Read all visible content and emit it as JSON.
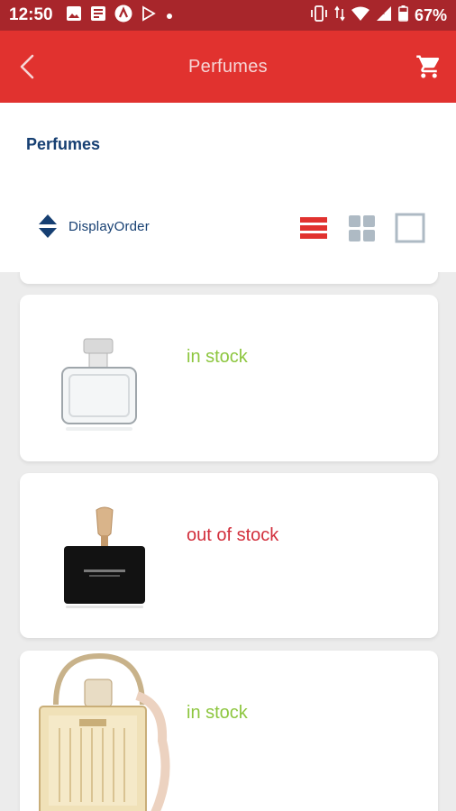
{
  "status_bar": {
    "time": "12:50",
    "battery": "67%",
    "icons": [
      "image-icon",
      "news-icon",
      "app-icon",
      "play-store-icon",
      "dot-icon",
      "vibrate-icon",
      "data-icon",
      "wifi-icon",
      "signal-icon",
      "battery-icon"
    ]
  },
  "app_bar": {
    "title": "Perfumes",
    "back_icon": "back-arrow-icon",
    "cart_icon": "cart-icon"
  },
  "category": {
    "title": "Perfumes"
  },
  "sort": {
    "label": "DisplayOrder",
    "icon": "sort-icon"
  },
  "view_modes": [
    {
      "name": "list-view",
      "active": true
    },
    {
      "name": "grid-view",
      "active": false
    },
    {
      "name": "single-view",
      "active": false
    }
  ],
  "products": [
    {
      "stock": "in stock",
      "in_stock": true,
      "image": "perfume-clear-bottle"
    },
    {
      "stock": "out of stock",
      "in_stock": false,
      "image": "perfume-black-bottle"
    },
    {
      "stock": "in stock",
      "in_stock": true,
      "image": "perfume-gold-bottle"
    }
  ],
  "colors": {
    "status_bar": "#a8262b",
    "app_bar": "#e1322f",
    "navy": "#163f72",
    "in_stock": "#8dc63f",
    "out_stock": "#d22f3c"
  }
}
